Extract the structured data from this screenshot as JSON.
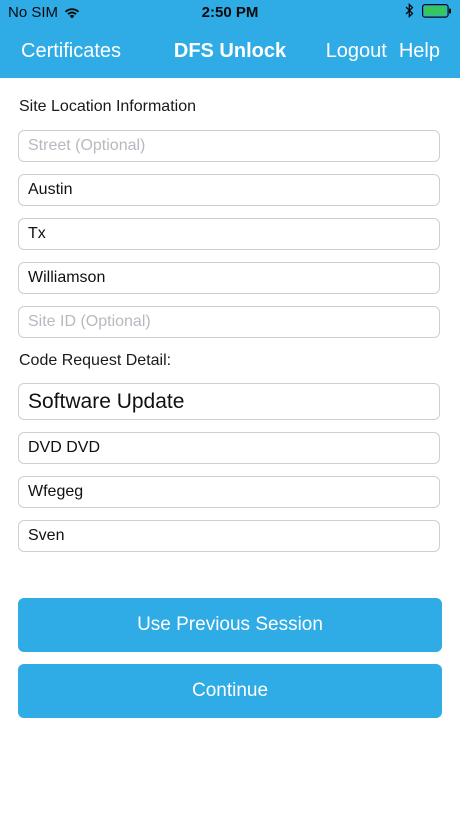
{
  "status_bar": {
    "carrier": "No SIM",
    "time": "2:50 PM",
    "icons": [
      "wifi-icon",
      "bluetooth-icon",
      "battery-icon"
    ],
    "battery_color": "#34c759"
  },
  "nav": {
    "left_label": "Certificates",
    "title": "DFS Unlock",
    "logout_label": "Logout",
    "help_label": "Help",
    "color": "#2fabe5"
  },
  "site_location": {
    "heading": "Site Location Information",
    "street": {
      "value": "",
      "placeholder": "Street (Optional)"
    },
    "city": {
      "value": "Austin"
    },
    "state": {
      "value": "Tx"
    },
    "county": {
      "value": "Williamson"
    },
    "site_id": {
      "value": "",
      "placeholder": "Site ID (Optional)"
    }
  },
  "code_request": {
    "heading": "Code Request Detail:",
    "reason": {
      "value": "Software Update"
    },
    "field_2": {
      "value": "DVD DVD"
    },
    "field_3": {
      "value": "Wfegeg"
    },
    "field_4": {
      "value": "Sven"
    }
  },
  "actions": {
    "use_previous_label": "Use Previous Session",
    "continue_label": "Continue"
  }
}
